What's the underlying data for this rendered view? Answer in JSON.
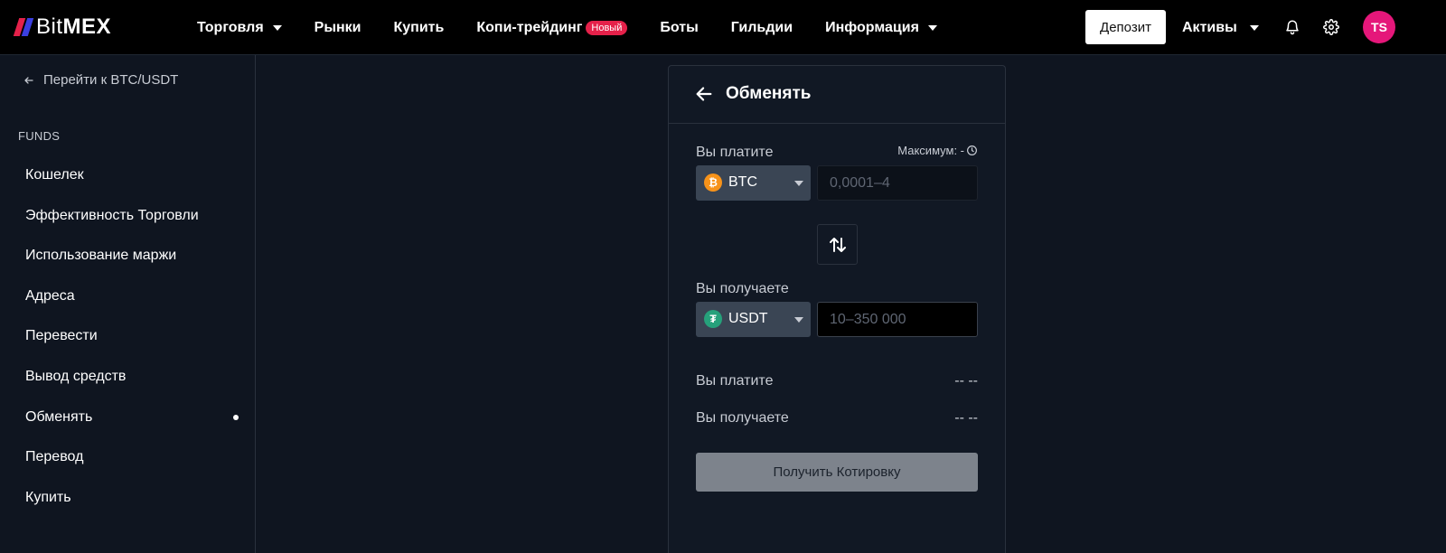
{
  "brand": {
    "logo_bold": "Bit",
    "logo_rest": "MEX"
  },
  "nav": {
    "trade": "Торговля",
    "markets": "Рынки",
    "buy": "Купить",
    "copy_trading": "Копи-трейдинг",
    "copy_badge": "Новый",
    "bots": "Боты",
    "guilds": "Гильдии",
    "info": "Информация"
  },
  "header": {
    "deposit": "Депозит",
    "assets": "Активы",
    "avatar_initials": "TS"
  },
  "sidebar": {
    "back": "Перейти к BTC/USDT",
    "section": "FUNDS",
    "items": [
      {
        "label": "Кошелек"
      },
      {
        "label": "Эффективность Торговли"
      },
      {
        "label": "Использование маржи"
      },
      {
        "label": "Адреса"
      },
      {
        "label": "Перевести"
      },
      {
        "label": "Вывод средств"
      },
      {
        "label": "Обменять"
      },
      {
        "label": "Перевод"
      },
      {
        "label": "Купить"
      }
    ]
  },
  "exchange": {
    "title": "Обменять",
    "pay_label": "Вы платите",
    "max_label": "Максимум: -",
    "pay_coin": "BTC",
    "pay_placeholder": "0,0001–4",
    "receive_label": "Вы получаете",
    "receive_coin": "USDT",
    "receive_placeholder": "10–350 000",
    "summary_pay_label": "Вы платите",
    "summary_pay_value": "-- --",
    "summary_receive_label": "Вы получаете",
    "summary_receive_value": "-- --",
    "quote_button": "Получить Котировку"
  },
  "colors": {
    "logo_red": "#e5214a",
    "logo_blue": "#3b3fe0",
    "btc": "#f7931a",
    "usdt": "#26a17b",
    "avatar": "#e5177a"
  }
}
